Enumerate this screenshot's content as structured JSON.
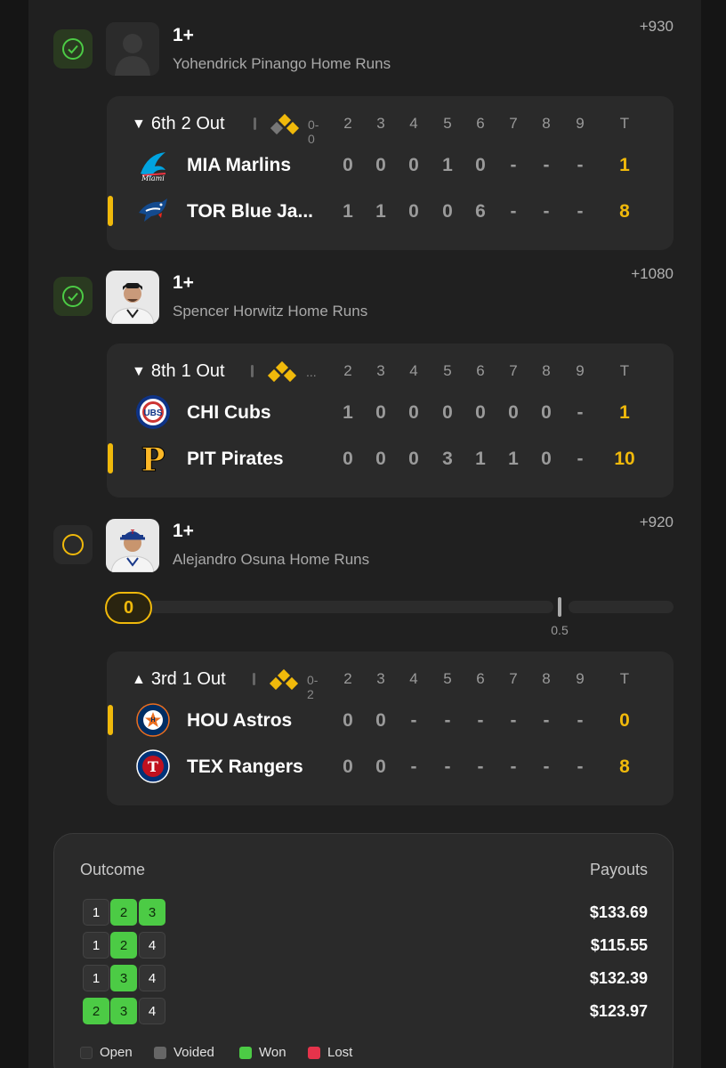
{
  "picks": [
    {
      "status": "won",
      "line": "1+",
      "description": "Yohendrick Pinango Home Runs",
      "odds": "+930",
      "avatar": "placeholder-avatar",
      "game": {
        "arrow": "▼",
        "inning": "6th",
        "outs": "2 Out",
        "mini_score": "0-0",
        "innings_header": [
          "2",
          "3",
          "4",
          "5",
          "6",
          "7",
          "8",
          "9"
        ],
        "total_header": "T",
        "teams": [
          {
            "abbr": "MIA Marlins",
            "scores": [
              "0",
              "0",
              "0",
              "1",
              "0",
              "-",
              "-",
              "-"
            ],
            "total": "1",
            "batting": false,
            "color": "#00a3e0"
          },
          {
            "abbr": "TOR Blue Ja...",
            "scores": [
              "1",
              "1",
              "0",
              "0",
              "6",
              "-",
              "-",
              "-"
            ],
            "total": "8",
            "batting": true,
            "color": "#134a8e"
          }
        ]
      }
    },
    {
      "status": "won",
      "line": "1+",
      "description": "Spencer Horwitz Home Runs",
      "odds": "+1080",
      "avatar": "player-photo",
      "game": {
        "arrow": "▼",
        "inning": "8th",
        "outs": "1 Out",
        "mini_score": "...",
        "innings_header": [
          "2",
          "3",
          "4",
          "5",
          "6",
          "7",
          "8",
          "9"
        ],
        "total_header": "T",
        "teams": [
          {
            "abbr": "CHI Cubs",
            "scores": [
              "1",
              "0",
              "0",
              "0",
              "0",
              "0",
              "0",
              "-"
            ],
            "total": "1",
            "batting": false,
            "color": "#0e3386"
          },
          {
            "abbr": "PIT Pirates",
            "scores": [
              "0",
              "0",
              "0",
              "3",
              "1",
              "1",
              "0",
              "-"
            ],
            "total": "10",
            "batting": true,
            "color": "#fdb827"
          }
        ]
      }
    },
    {
      "status": "open",
      "line": "1+",
      "description": "Alejandro Osuna Home Runs",
      "odds": "+920",
      "avatar": "player-photo",
      "progress": {
        "current": "0",
        "target": "0.5"
      },
      "game": {
        "arrow": "▲",
        "inning": "3rd",
        "outs": "1 Out",
        "mini_score": "0-2",
        "innings_header": [
          "2",
          "3",
          "4",
          "5",
          "6",
          "7",
          "8",
          "9"
        ],
        "total_header": "T",
        "teams": [
          {
            "abbr": "HOU Astros",
            "scores": [
              "0",
              "0",
              "-",
              "-",
              "-",
              "-",
              "-",
              "-"
            ],
            "total": "0",
            "batting": true,
            "color": "#eb6e1f"
          },
          {
            "abbr": "TEX Rangers",
            "scores": [
              "0",
              "0",
              "-",
              "-",
              "-",
              "-",
              "-",
              "-"
            ],
            "total": "8",
            "batting": false,
            "color": "#c0111f"
          }
        ]
      }
    }
  ],
  "summary": {
    "outcome_label": "Outcome",
    "payouts_label": "Payouts",
    "rows": [
      {
        "cells": [
          {
            "n": "1",
            "s": "open"
          },
          {
            "n": "2",
            "s": "won"
          },
          {
            "n": "3",
            "s": "won"
          }
        ],
        "payout": "$133.69"
      },
      {
        "cells": [
          {
            "n": "1",
            "s": "open"
          },
          {
            "n": "2",
            "s": "won"
          },
          {
            "n": "4",
            "s": "open"
          }
        ],
        "payout": "$115.55"
      },
      {
        "cells": [
          {
            "n": "1",
            "s": "open"
          },
          {
            "n": "3",
            "s": "won"
          },
          {
            "n": "4",
            "s": "open"
          }
        ],
        "payout": "$132.39"
      },
      {
        "cells": [
          {
            "n": "2",
            "s": "won"
          },
          {
            "n": "3",
            "s": "won"
          },
          {
            "n": "4",
            "s": "open"
          }
        ],
        "payout": "$123.97"
      }
    ],
    "legend": [
      {
        "label": "Open",
        "color": "#333333"
      },
      {
        "label": "Voided",
        "color": "#666666"
      },
      {
        "label": "Won",
        "color": "#4ccb45"
      },
      {
        "label": "Lost",
        "color": "#e5334b"
      }
    ]
  },
  "colors": {
    "accent": "#f0b90b",
    "won": "#4ccb45"
  }
}
